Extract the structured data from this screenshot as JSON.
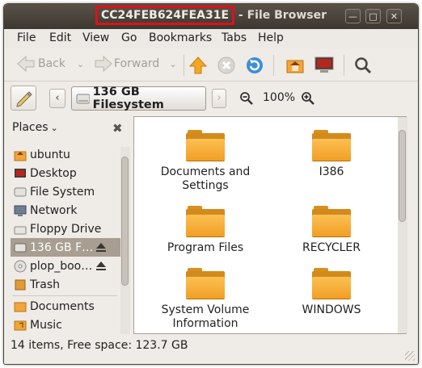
{
  "window": {
    "title_highlight": "CC24FEB624FEA31E",
    "title_rest": " - File Browser",
    "controls": [
      "minimize",
      "maximize",
      "close"
    ]
  },
  "menu": [
    "File",
    "Edit",
    "View",
    "Go",
    "Bookmarks",
    "Tabs",
    "Help"
  ],
  "toolbar": {
    "back_label": "Back",
    "forward_label": "Forward",
    "icons": [
      "back-arrow-icon",
      "forward-arrow-icon",
      "up-arrow-icon",
      "stop-icon",
      "reload-icon",
      "home-folder-icon",
      "computer-icon",
      "search-icon"
    ]
  },
  "location": {
    "path_button": "136 GB Filesystem",
    "zoom": "100%"
  },
  "sidebar": {
    "header": "Places",
    "items": [
      {
        "label": "ubuntu",
        "icon": "home-folder-icon"
      },
      {
        "label": "Desktop",
        "icon": "desktop-icon"
      },
      {
        "label": "File System",
        "icon": "drive-icon"
      },
      {
        "label": "Network",
        "icon": "network-icon"
      },
      {
        "label": "Floppy Drive",
        "icon": "floppy-icon"
      },
      {
        "label": "136 GB F…",
        "icon": "drive-icon",
        "selected": true,
        "eject": true
      },
      {
        "label": "plop_boo…",
        "icon": "cd-icon",
        "eject": true
      },
      {
        "label": "Trash",
        "icon": "trash-icon"
      },
      {
        "label": "Documents",
        "icon": "folder-icon"
      },
      {
        "label": "Music",
        "icon": "music-folder-icon"
      }
    ]
  },
  "files": [
    {
      "name": "Documents and\nSettings"
    },
    {
      "name": "I386"
    },
    {
      "name": "Program Files"
    },
    {
      "name": "RECYCLER"
    },
    {
      "name": "System Volume\nInformation"
    },
    {
      "name": "WINDOWS"
    }
  ],
  "status": "14 items, Free space: 123.7 GB",
  "colors": {
    "title_highlight_border": "#e0101a",
    "folder": "#f5a52a",
    "selection": "#a89e92"
  }
}
